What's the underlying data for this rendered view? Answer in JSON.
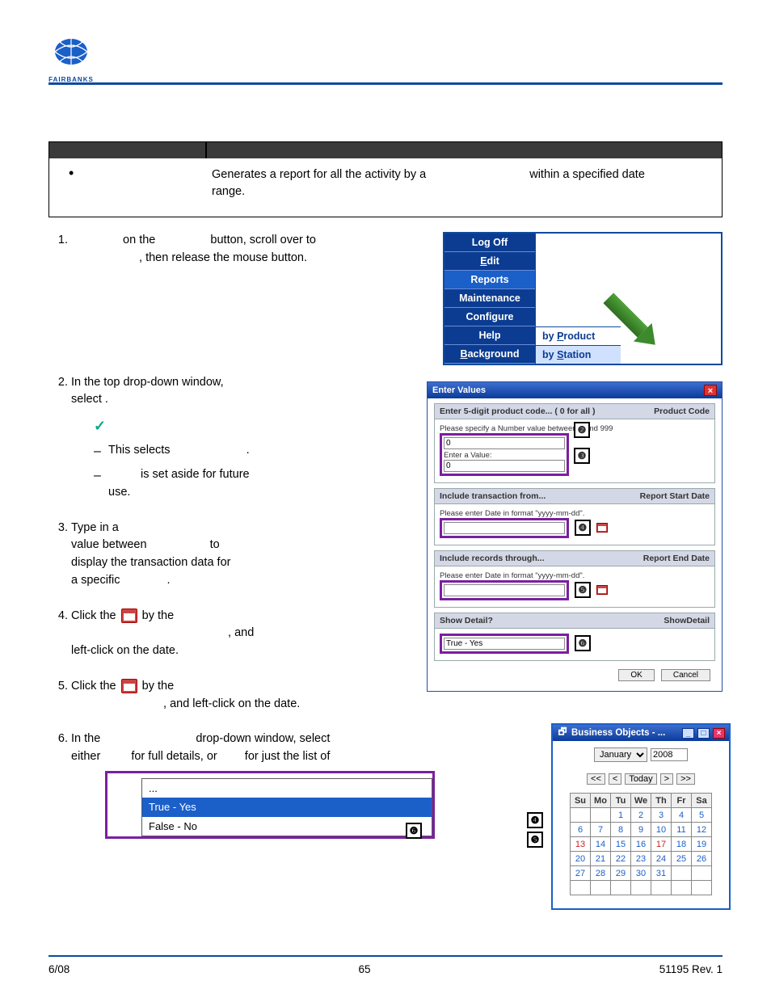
{
  "logo_name": "FAIRBANKS",
  "grey": {
    "cell1": "",
    "cell2": "",
    "bullet": "•",
    "desc_a": "Generates a report for all the activity by a",
    "desc_b": "within a specified date",
    "desc_c": "range."
  },
  "steps": {
    "s1_a": "on the",
    "s1_b": "button, scroll over to",
    "s1_c": ", then release the mouse button.",
    "s2_a": "In the top drop-down window,",
    "s2_b": "select",
    "s2_dot": "   .",
    "s2_check": "✓",
    "s2_d1a": "This selects",
    "s2_d1b": "  .",
    "s2_d2a": "is set aside for future",
    "s2_d2b": "use.",
    "s3_a": "Type in a",
    "s3_b": "value between",
    "s3_c": "to",
    "s3_d": "display the transaction data for",
    "s3_e": "a specific",
    "s3_f": "  .",
    "s4_a": "Click the",
    "s4_b": "by the",
    "s4_c": ", and",
    "s4_d": "left-click on the date.",
    "s5_a": "Click the",
    "s5_b": "by the",
    "s5_c": ", and left-click on the date.",
    "s6_a": "In the",
    "s6_b": "drop-down window, select",
    "s6_c": "either",
    "s6_d": "for full details, or",
    "s6_e": "for just the list of"
  },
  "menu": {
    "items": [
      "Log Off",
      "Edit",
      "Reports",
      "Maintenance",
      "Configure",
      "Help",
      "Background"
    ],
    "underline_idx": [
      1,
      6
    ],
    "selected_idx": 2,
    "sub": [
      "by Product",
      "by Station"
    ],
    "sub_underline_pos": [
      3,
      3
    ],
    "sub_selected_idx": 1
  },
  "dlg": {
    "title": "Enter Values",
    "sect1": {
      "h": "Enter 5-digit product code... ( 0 for all )",
      "r": "Product Code",
      "hint": "Please specify a Number value between 0 and 999",
      "lbl": "Enter a Value:",
      "v1": "0",
      "v2": "0"
    },
    "sect2": {
      "h": "Include transaction from...",
      "r": "Report Start Date",
      "hint": "Please enter Date in format \"yyyy-mm-dd\"."
    },
    "sect3": {
      "h": "Include records through...",
      "r": "Report End Date",
      "hint": "Please enter Date in format \"yyyy-mm-dd\"."
    },
    "sect4": {
      "h": "Show Detail?",
      "r": "ShowDetail",
      "val": "True - Yes"
    },
    "ok": "OK",
    "cancel": "Cancel"
  },
  "badges": {
    "b2": "❷",
    "b3": "❸",
    "b4": "❹",
    "b5": "❺",
    "b6": "❻",
    "p4": "❹",
    "p5": "❺",
    "p6": "❻"
  },
  "dd": {
    "r0": "...",
    "r1": "True  - Yes",
    "r2": "False - No"
  },
  "cal": {
    "title": "Business Objects - ...",
    "month": "January",
    "year": "2008",
    "nav": {
      "first": "<<",
      "prev": "<",
      "today": "Today",
      "next": ">",
      "last": ">>"
    },
    "dow": [
      "Su",
      "Mo",
      "Tu",
      "We",
      "Th",
      "Fr",
      "Sa"
    ],
    "rows": [
      [
        "",
        "",
        "1",
        "2",
        "3",
        "4",
        "5"
      ],
      [
        "6",
        "7",
        "8",
        "9",
        "10",
        "11",
        "12"
      ],
      [
        "13",
        "14",
        "15",
        "16",
        "17",
        "18",
        "19"
      ],
      [
        "20",
        "21",
        "22",
        "23",
        "24",
        "25",
        "26"
      ],
      [
        "27",
        "28",
        "29",
        "30",
        "31",
        "",
        ""
      ],
      [
        "",
        "",
        "",
        "",
        "",
        "",
        ""
      ]
    ]
  },
  "footer": {
    "left": "6/08",
    "center": "65",
    "right": "51195     Rev. 1"
  }
}
